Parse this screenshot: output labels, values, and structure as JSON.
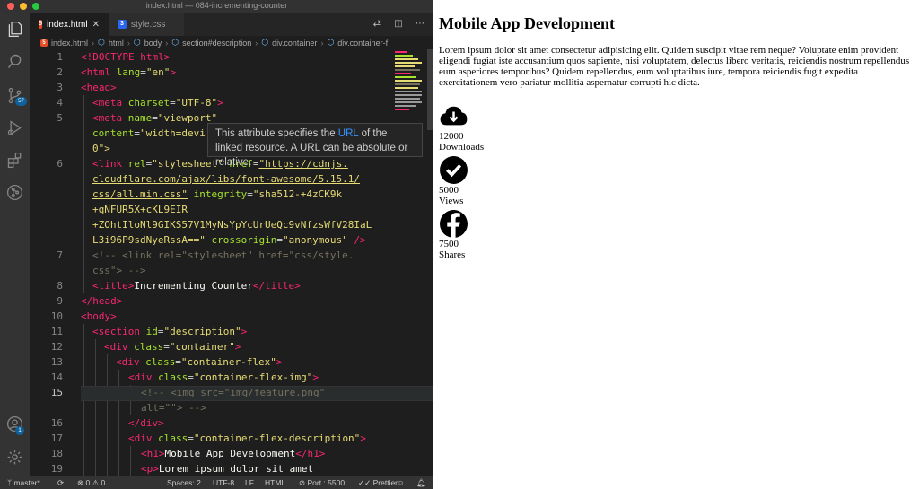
{
  "window": {
    "title": "index.html — 084-incrementing-counter"
  },
  "activity_bar": {
    "scm_badge": "57",
    "account_badge": "1"
  },
  "tabs": [
    {
      "label": "index.html",
      "active": true,
      "icon": "html5-icon"
    },
    {
      "label": "style.css",
      "active": false,
      "icon": "css3-icon"
    }
  ],
  "breadcrumb": [
    "index.html",
    "html",
    "body",
    "section#description",
    "div.container",
    "div.container-f"
  ],
  "editor": {
    "lines": [
      {
        "n": "1"
      },
      {
        "n": "2"
      },
      {
        "n": "3"
      },
      {
        "n": "4"
      },
      {
        "n": "5"
      },
      {
        "n": "6"
      },
      {
        "n": "7"
      },
      {
        "n": "8"
      },
      {
        "n": "9"
      },
      {
        "n": "10"
      },
      {
        "n": "11"
      },
      {
        "n": "12"
      },
      {
        "n": "13"
      },
      {
        "n": "14"
      },
      {
        "n": "15"
      },
      {
        "n": "16"
      },
      {
        "n": "17"
      },
      {
        "n": "18"
      },
      {
        "n": "19"
      }
    ],
    "code": {
      "l1": "<!DOCTYPE html>",
      "l2_tag": "<html",
      "l2_attr": "lang",
      "l2_val": "\"en\"",
      "l3": "<head>",
      "l4_tag": "<meta",
      "l4_attr": "charset",
      "l4_val": "\"UTF-8\"",
      "l5_tag": "<meta",
      "l5_attr": "name",
      "l5_val": "\"viewport\"",
      "l5b_attr": "content",
      "l5b_val": "\"width=devi",
      "l5c": "0\">",
      "l6_tag": "<link",
      "l6_attr1": "rel",
      "l6_val1": "\"stylesheet\"",
      "l6_attr2": "href",
      "l6_url1": "\"https://cdnjs.",
      "l6_url2": "cloudflare.com/ajax/libs/font-awesome/5.15.1/",
      "l6_url3": "css/all.min.css\"",
      "l6_attr3": "integrity",
      "l6_val3": "\"sha512-+4zCK9k",
      "l6_val4": "+qNFUR5X+cKL9EIR",
      "l6_val5": "+ZOhtIloNl9GIKS57V1MyNsYpYcUrUeQc9vNfzsWfV28IaL",
      "l6_val6": "L3i96P9sdNyeRssA==\"",
      "l6_attr4": "crossorigin",
      "l6_val7": "\"anonymous\"",
      "l6_end": "/>",
      "l7a": "<!-- <link rel=\"stylesheet\" href=\"css/style.",
      "l7b": "css\"> -->",
      "l8_open": "<title>",
      "l8_text": "Incrementing Counter",
      "l8_close": "</title>",
      "l9": "</head>",
      "l10": "<body>",
      "l11_tag": "<section",
      "l11_attr": "id",
      "l11_val": "\"description\"",
      "l12_tag": "<div",
      "l12_attr": "class",
      "l12_val": "\"container\"",
      "l13_tag": "<div",
      "l13_attr": "class",
      "l13_val": "\"container-flex\"",
      "l14_tag": "<div",
      "l14_attr": "class",
      "l14_val": "\"container-flex-img\"",
      "l15a": "<!-- <img src=\"img/feature.png\"",
      "l15b": "alt=\"\"> -->",
      "l16": "</div>",
      "l17_tag": "<div",
      "l17_attr": "class",
      "l17_val": "\"container-flex-description\"",
      "l18_open": "<h1>",
      "l18_text": "Mobile App Development",
      "l18_close": "</h1>",
      "l19_open": "<p>",
      "l19_text": "Lorem ipsum dolor sit amet"
    }
  },
  "tooltip": {
    "pre": "This attribute specifies the ",
    "link": "URL",
    "post": " of the linked resource. A URL can be absolute or relative."
  },
  "statusbar": {
    "branch": "master*",
    "problems": "⊗ 0 ⚠ 0",
    "spaces": "Spaces: 2",
    "encoding": "UTF-8",
    "eol": "LF",
    "language": "HTML",
    "port": "Port : 5500",
    "prettier": "Prettier"
  },
  "preview": {
    "title": "Mobile App Development",
    "text": "Lorem ipsum dolor sit amet consectetur adipisicing elit. Quidem suscipit vitae rem neque? Voluptate enim provident eligendi fugiat iste accusantium quos sapiente, nisi voluptatem, delectus libero veritatis, reiciendis nostrum repellendus eum asperiores temporibus? Quidem repellendus, eum voluptatibus iure, tempora reiciendis fugit expedita exercitationem vero pariatur mollitia aspernatur corrupti hic dicta.",
    "stats": [
      {
        "icon": "cloud-download-icon",
        "number": "12000",
        "label": "Downloads"
      },
      {
        "icon": "check-circle-icon",
        "number": "5000",
        "label": "Views"
      },
      {
        "icon": "facebook-icon",
        "number": "7500",
        "label": "Shares"
      }
    ]
  }
}
